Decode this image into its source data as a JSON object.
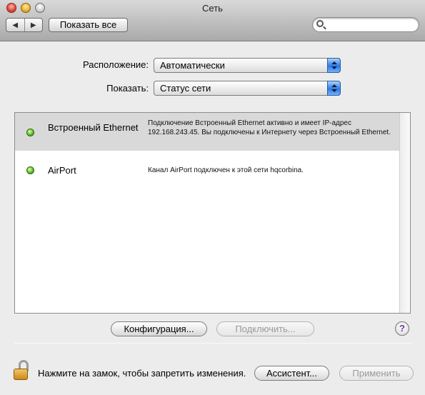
{
  "window": {
    "title": "Сеть"
  },
  "toolbar": {
    "back_glyph": "◀",
    "forward_glyph": "▶",
    "show_all_label": "Показать все",
    "search_placeholder": ""
  },
  "location": {
    "label": "Расположение:",
    "value": "Автоматически"
  },
  "show": {
    "label": "Показать:",
    "value": "Статус сети"
  },
  "services": [
    {
      "name": "Встроенный Ethernet",
      "status_color": "#5fc02a",
      "description": "Подключение Встроенный Ethernet активно и имеет IP-адрес 192.168.243.45. Вы подключены к Интернету через Встроенный Ethernet.",
      "selected": true
    },
    {
      "name": "AirPort",
      "status_color": "#5fc02a",
      "description": "Канал AirPort подключен к этой сети hqcorbina.",
      "selected": false
    }
  ],
  "actions": {
    "configure_label": "Конфигурация...",
    "connect_label": "Подключить...",
    "help_label": "?"
  },
  "footer": {
    "lock_text": "Нажмите на замок, чтобы запретить изменения.",
    "assistant_label": "Ассистент...",
    "apply_label": "Применить"
  }
}
